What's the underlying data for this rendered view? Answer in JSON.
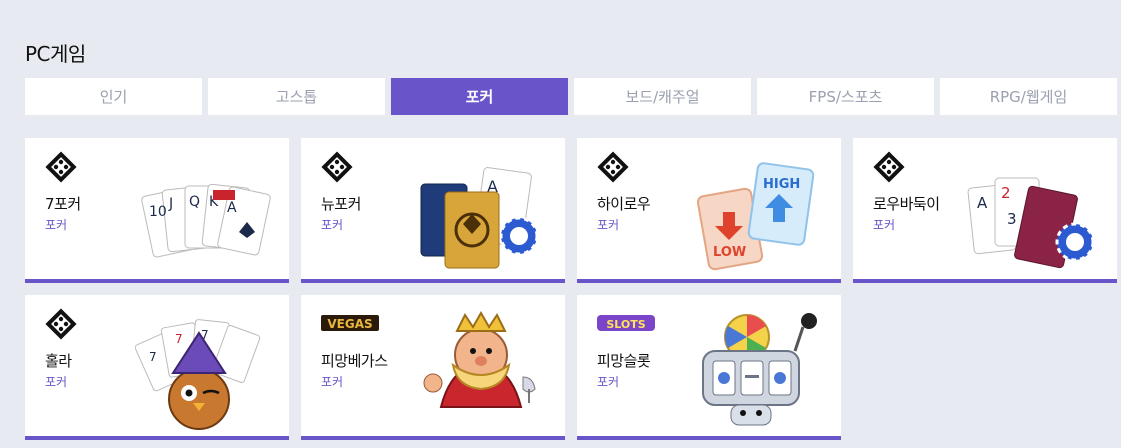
{
  "section_title": "PC게임",
  "tabs": [
    {
      "label": "인기",
      "active": false
    },
    {
      "label": "고스톱",
      "active": false
    },
    {
      "label": "포커",
      "active": true
    },
    {
      "label": "보드/캐주얼",
      "active": false
    },
    {
      "label": "FPS/스포츠",
      "active": false
    },
    {
      "label": "RPG/웹게임",
      "active": false
    }
  ],
  "games": [
    {
      "name": "7포커",
      "category": "포커",
      "icon": "diamond-logo-icon",
      "art": "playing-cards-icon"
    },
    {
      "name": "뉴포커",
      "category": "포커",
      "icon": "diamond-logo-icon",
      "art": "cards-and-chips-icon"
    },
    {
      "name": "하이로우",
      "category": "포커",
      "icon": "diamond-logo-icon",
      "art": "high-low-cards-icon"
    },
    {
      "name": "로우바둑이",
      "category": "포커",
      "icon": "diamond-logo-icon",
      "art": "cards-and-chips-icon"
    },
    {
      "name": "홀라",
      "category": "포커",
      "icon": "diamond-logo-icon",
      "art": "wizard-owl-icon"
    },
    {
      "name": "피망베가스",
      "category": "포커",
      "icon": "vegas-logo-icon",
      "icon_text": "VEGAS",
      "art": "king-character-icon"
    },
    {
      "name": "피망슬롯",
      "category": "포커",
      "icon": "slots-logo-icon",
      "icon_text": "SLOTS",
      "art": "slot-machine-icon"
    }
  ],
  "colors": {
    "accent": "#6a54c9",
    "background": "#e8eaf1",
    "tab_inactive_text": "#9aa0ae"
  }
}
